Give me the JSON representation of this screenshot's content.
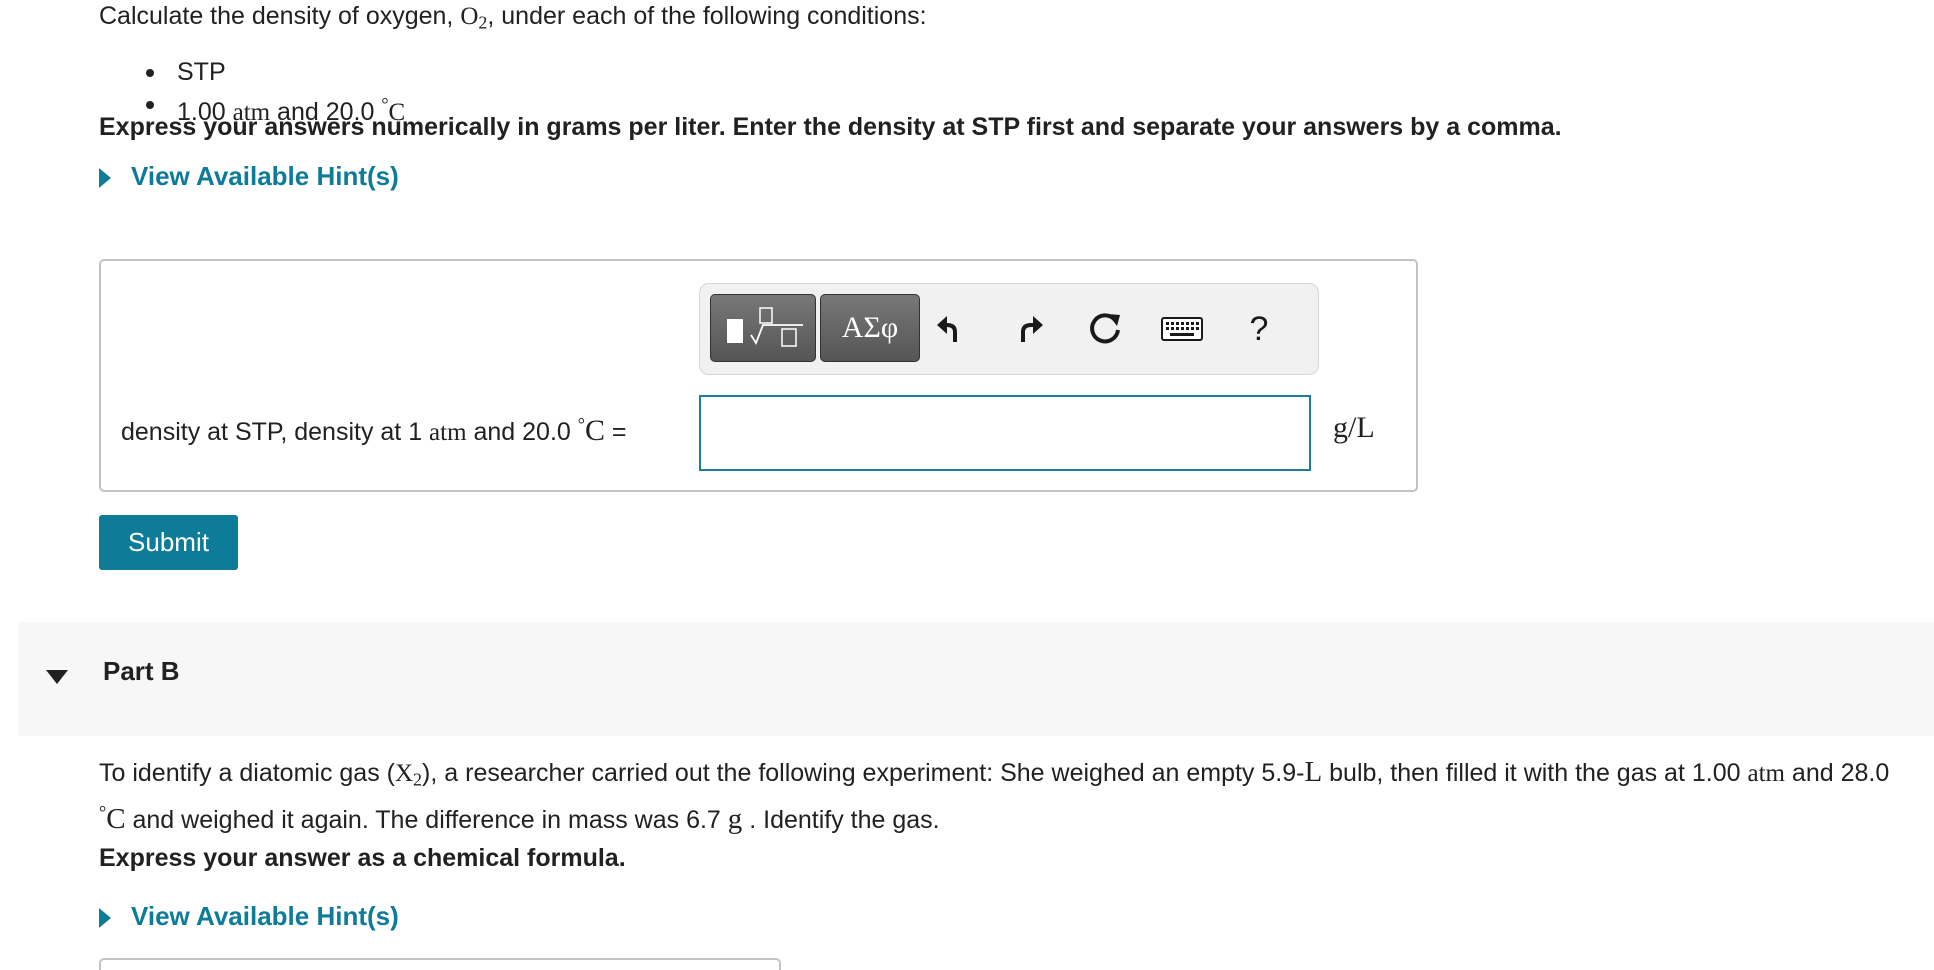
{
  "part_a": {
    "prompt": {
      "pre": "Calculate the density of oxygen, ",
      "formula": "O",
      "formula_sub": "2",
      "post": ", under each of the following conditions:"
    },
    "conditions": [
      {
        "text": "STP"
      },
      {
        "pre": "1.00 ",
        "unit1": "atm",
        "mid": " and 20.0 ",
        "deg": "°",
        "unit2": "C"
      }
    ],
    "instruction": "Express your answers numerically in grams per liter. Enter the density at STP first and separate your answers by a comma.",
    "hint_label": "View Available Hint(s)",
    "toolbar": {
      "templates_icon": "fraction-sqrt-template-icon",
      "symbols_label": "ΑΣφ",
      "undo_icon": "undo-icon",
      "redo_icon": "redo-icon",
      "reset_icon": "reset-icon",
      "keyboard_icon": "keyboard-icon",
      "help_label": "?"
    },
    "field": {
      "label_pre": "density at STP, density at 1 ",
      "label_unit": "atm",
      "label_mid": " and 20.0 ",
      "label_deg": "°",
      "label_c": "C",
      "label_eq": " =",
      "value": "",
      "unit": "g/L"
    },
    "submit_label": "Submit"
  },
  "part_b": {
    "title": "Part B",
    "problem": {
      "t1": "To identify a diatomic gas (",
      "formula": "X",
      "formula_sub": "2",
      "t2": "), a researcher carried out the following experiment: She weighed an empty 5.9-",
      "u1": "L",
      "t3": " bulb, then filled it with the gas at 1.00 ",
      "u2": "atm",
      "t4": " and 28.0 ",
      "deg": "°",
      "u3": "C",
      "t5": " and weighed it again. The difference in mass was 6.7 ",
      "u4": "g",
      "t6": " . Identify the gas."
    },
    "instruction": "Express your answer as a chemical formula.",
    "hint_label": "View Available Hint(s)"
  },
  "colors": {
    "accent": "#0e7c99",
    "text": "#212121",
    "toolbar_bg": "#f1f1f1",
    "header_bg": "#f7f7f7"
  }
}
